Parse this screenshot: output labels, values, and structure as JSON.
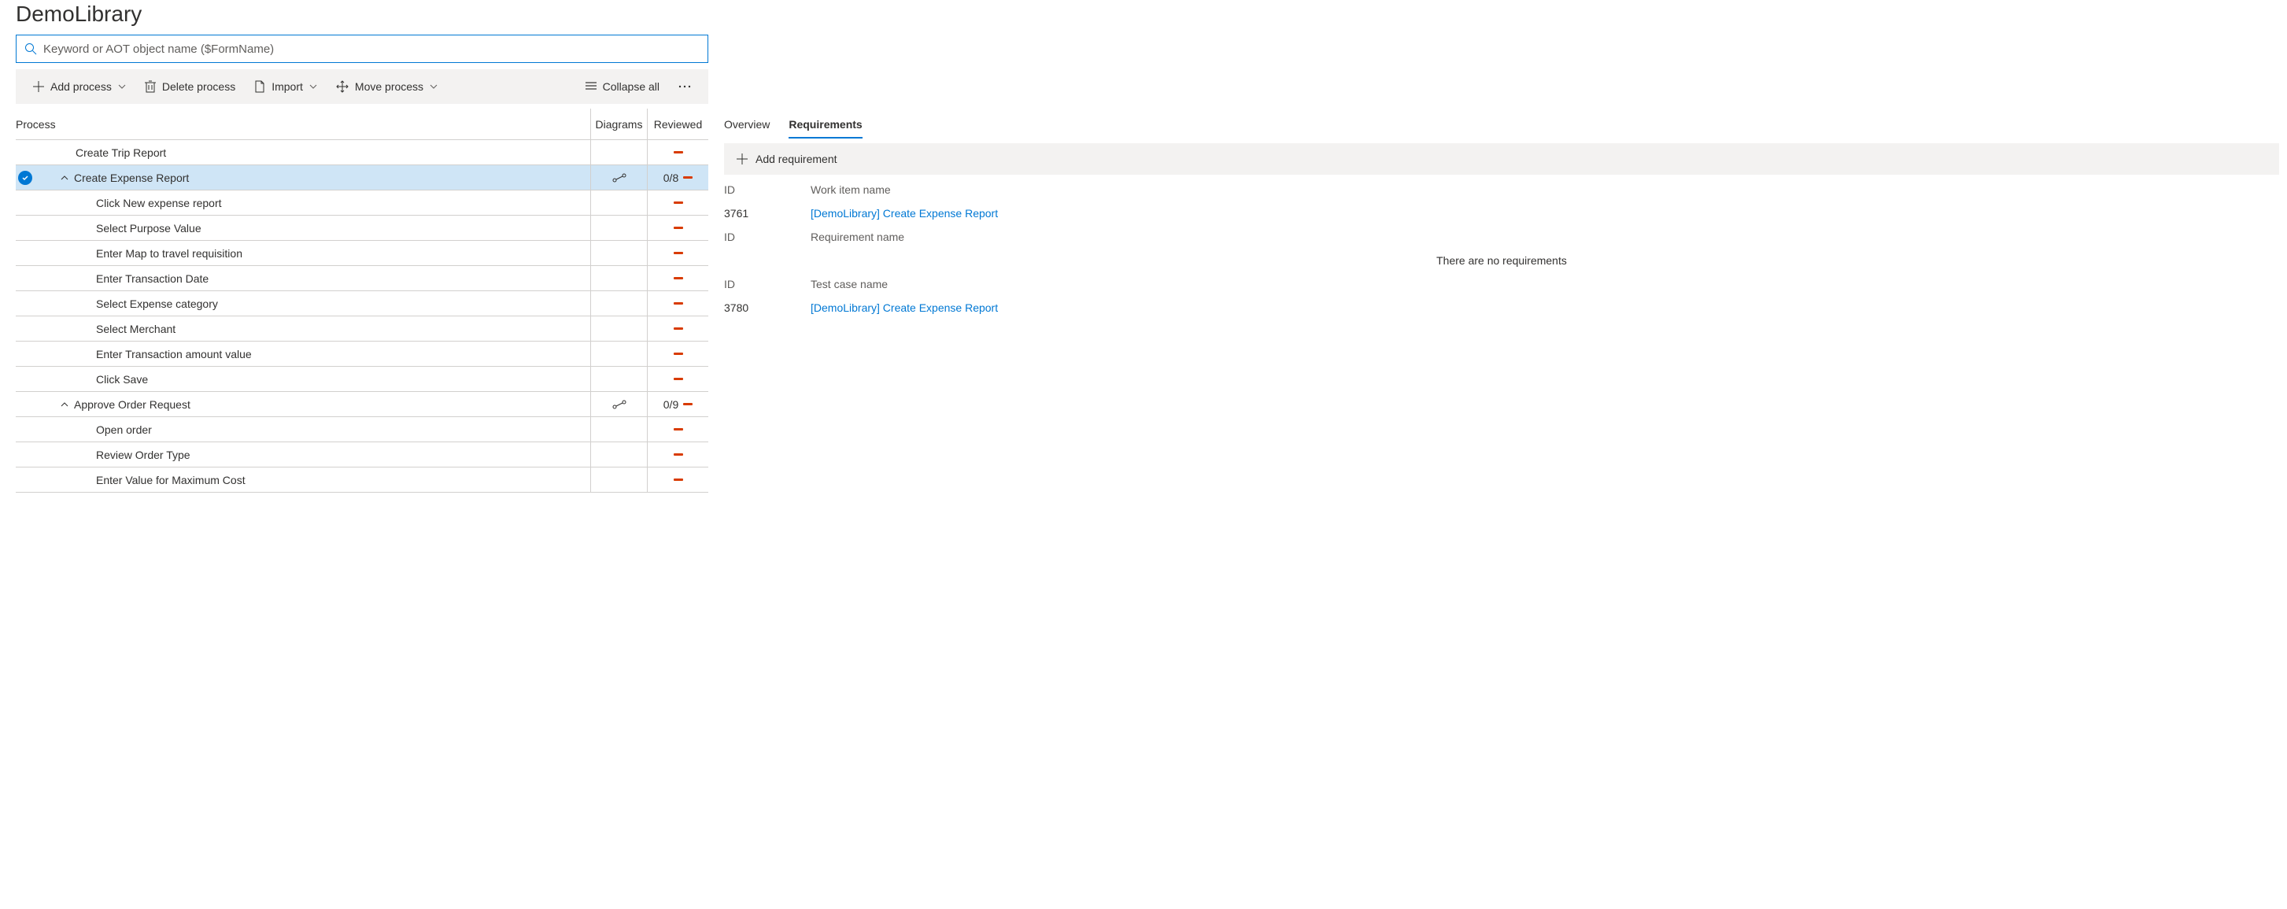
{
  "title": "DemoLibrary",
  "search": {
    "placeholder": "Keyword or AOT object name ($FormName)"
  },
  "toolbar": {
    "add_process": "Add process",
    "delete_process": "Delete process",
    "import": "Import",
    "move_process": "Move process",
    "collapse_all": "Collapse all"
  },
  "columns": {
    "process": "Process",
    "diagrams": "Diagrams",
    "reviewed": "Reviewed"
  },
  "rows": [
    {
      "label": "Create Trip Report",
      "indent": 1,
      "expandable": false,
      "selected": false,
      "diagram": false,
      "reviewed_text": ""
    },
    {
      "label": "Create Expense Report",
      "indent": 1,
      "expandable": true,
      "selected": true,
      "diagram": true,
      "reviewed_text": "0/8"
    },
    {
      "label": "Click New expense report",
      "indent": 2,
      "expandable": false,
      "selected": false,
      "diagram": false,
      "reviewed_text": ""
    },
    {
      "label": "Select Purpose Value",
      "indent": 2,
      "expandable": false,
      "selected": false,
      "diagram": false,
      "reviewed_text": ""
    },
    {
      "label": "Enter Map to travel requisition",
      "indent": 2,
      "expandable": false,
      "selected": false,
      "diagram": false,
      "reviewed_text": ""
    },
    {
      "label": "Enter Transaction Date",
      "indent": 2,
      "expandable": false,
      "selected": false,
      "diagram": false,
      "reviewed_text": ""
    },
    {
      "label": "Select Expense category",
      "indent": 2,
      "expandable": false,
      "selected": false,
      "diagram": false,
      "reviewed_text": ""
    },
    {
      "label": "Select Merchant",
      "indent": 2,
      "expandable": false,
      "selected": false,
      "diagram": false,
      "reviewed_text": ""
    },
    {
      "label": "Enter Transaction amount value",
      "indent": 2,
      "expandable": false,
      "selected": false,
      "diagram": false,
      "reviewed_text": ""
    },
    {
      "label": "Click Save",
      "indent": 2,
      "expandable": false,
      "selected": false,
      "diagram": false,
      "reviewed_text": ""
    },
    {
      "label": "Approve Order Request",
      "indent": 1,
      "expandable": true,
      "selected": false,
      "diagram": true,
      "reviewed_text": "0/9"
    },
    {
      "label": "Open order",
      "indent": 2,
      "expandable": false,
      "selected": false,
      "diagram": false,
      "reviewed_text": ""
    },
    {
      "label": "Review Order Type",
      "indent": 2,
      "expandable": false,
      "selected": false,
      "diagram": false,
      "reviewed_text": ""
    },
    {
      "label": "Enter Value for Maximum Cost",
      "indent": 2,
      "expandable": false,
      "selected": false,
      "diagram": false,
      "reviewed_text": ""
    }
  ],
  "tabs": {
    "overview": "Overview",
    "requirements": "Requirements"
  },
  "req_toolbar": {
    "add": "Add requirement"
  },
  "req_sections": {
    "id_label": "ID",
    "work_item_name": "Work item name",
    "requirement_name": "Requirement name",
    "test_case_name": "Test case name",
    "no_requirements": "There are no requirements"
  },
  "work_item": {
    "id": "3761",
    "name": "[DemoLibrary] Create Expense Report"
  },
  "test_case": {
    "id": "3780",
    "name": "[DemoLibrary] Create Expense Report"
  }
}
